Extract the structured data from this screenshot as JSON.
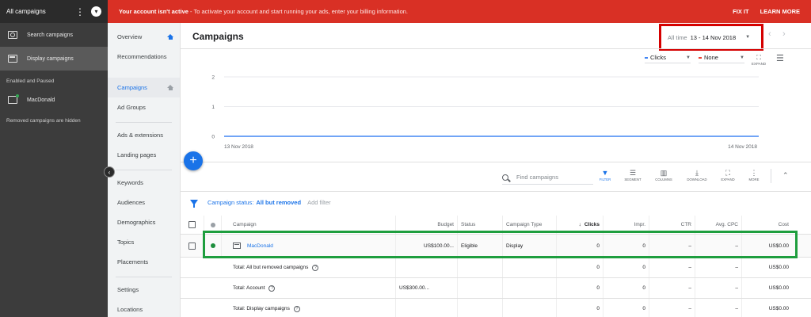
{
  "sidebar": {
    "header": "All campaigns",
    "items": [
      {
        "label": "Search campaigns",
        "icon": "search-campaign-icon"
      },
      {
        "label": "Display campaigns",
        "icon": "display-campaign-icon"
      }
    ],
    "subheading": "Enabled and Paused",
    "campaign": "MacDonald",
    "note": "Removed campaigns are hidden"
  },
  "banner": {
    "bold": "Your account isn't active",
    "rest": " - To activate your account and start running your ads, enter your billing information.",
    "fix": "FIX IT",
    "learn": "LEARN MORE",
    "color": "#d93025"
  },
  "nav": {
    "items": [
      "Overview",
      "Recommendations",
      "Campaigns",
      "Ad Groups",
      "Ads & extensions",
      "Landing pages",
      "Keywords",
      "Audiences",
      "Demographics",
      "Topics",
      "Placements",
      "Settings",
      "Locations"
    ]
  },
  "header": {
    "title": "Campaigns",
    "date_label": "All time",
    "date_value": "13 - 14 Nov 2018"
  },
  "chart_controls": {
    "metric1": "Clicks",
    "metric1_color": "#4285f4",
    "metric2": "None",
    "metric2_color": "#ea4335",
    "expand": "EXPAND"
  },
  "chart_data": {
    "type": "line",
    "x": [
      "13 Nov 2018",
      "14 Nov 2018"
    ],
    "series": [
      {
        "values": [
          0,
          0
        ]
      }
    ],
    "yticks": [
      "2",
      "1",
      "0"
    ],
    "ylim": [
      0,
      2
    ],
    "color": "#4285f4"
  },
  "toolbar": {
    "search_placeholder": "Find campaigns",
    "tools": [
      "FILTER",
      "SEGMENT",
      "COLUMNS",
      "DOWNLOAD",
      "EXPAND",
      "MORE"
    ]
  },
  "filter": {
    "label": "Campaign status:",
    "value": "All but removed",
    "add": "Add filter"
  },
  "table": {
    "headers": {
      "campaign": "Campaign",
      "budget": "Budget",
      "status": "Status",
      "type": "Campaign Type",
      "clicks": "Clicks",
      "impr": "Impr.",
      "ctr": "CTR",
      "cpc": "Avg. CPC",
      "cost": "Cost"
    },
    "campaign_row": {
      "name": "MacDonald",
      "budget": "US$100.00...",
      "status": "Eligible",
      "type": "Display",
      "clicks": "0",
      "impr": "0",
      "ctr": "–",
      "cpc": "–",
      "cost": "US$0.00"
    },
    "totals": [
      {
        "label": "Total: All but removed campaigns",
        "budget": "",
        "clicks": "0",
        "impr": "0",
        "ctr": "–",
        "cpc": "–",
        "cost": "US$0.00"
      },
      {
        "label": "Total: Account",
        "budget": "US$300.00...",
        "clicks": "0",
        "impr": "0",
        "ctr": "–",
        "cpc": "–",
        "cost": "US$0.00"
      },
      {
        "label": "Total: Display campaigns",
        "budget": "",
        "clicks": "0",
        "impr": "0",
        "ctr": "–",
        "cpc": "–",
        "cost": "US$0.00"
      }
    ]
  }
}
